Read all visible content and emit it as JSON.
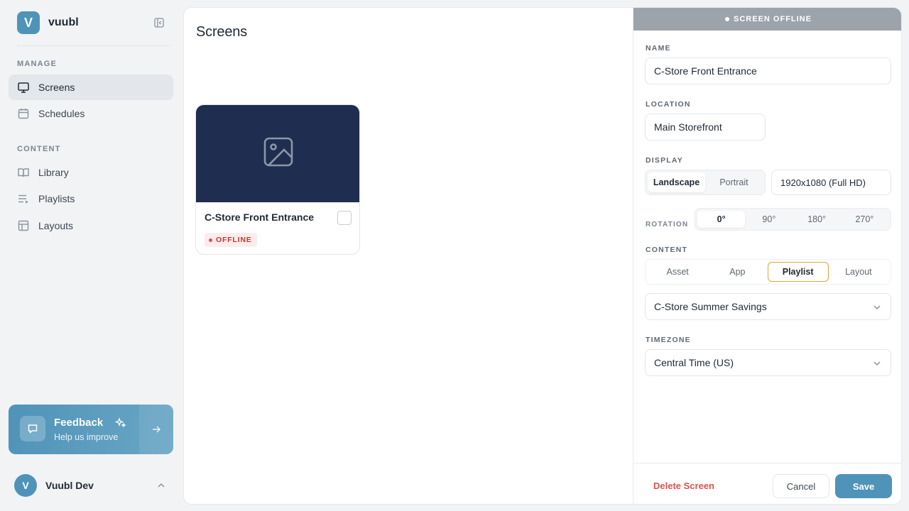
{
  "brand": {
    "logo_letter": "V",
    "name": "vuubl"
  },
  "sidebar": {
    "sections": [
      {
        "label": "MANAGE"
      },
      {
        "label": "CONTENT"
      }
    ],
    "items": [
      {
        "label": "Screens",
        "icon": "monitor-icon",
        "active": true
      },
      {
        "label": "Schedules",
        "icon": "calendar-icon"
      },
      {
        "label": "Library",
        "icon": "book-icon"
      },
      {
        "label": "Playlists",
        "icon": "playlist-icon"
      },
      {
        "label": "Layouts",
        "icon": "layout-icon"
      }
    ],
    "feedback": {
      "title": "Feedback",
      "subtitle": "Help us improve"
    },
    "user": {
      "initial": "V",
      "name": "Vuubl Dev"
    }
  },
  "main": {
    "title": "Screens",
    "cards": [
      {
        "name": "C-Store Front Entrance",
        "status": "OFFLINE"
      }
    ]
  },
  "drawer": {
    "banner": "SCREEN OFFLINE",
    "name_label": "NAME",
    "name_value": "C-Store Front Entrance",
    "location_label": "LOCATION",
    "location_value": "Main Storefront",
    "display_label": "DISPLAY",
    "orientation_options": [
      "Landscape",
      "Portrait"
    ],
    "orientation_selected": "Landscape",
    "resolution": "1920x1080 (Full HD)",
    "rotation_label": "ROTATION",
    "rotation_options": [
      "0°",
      "90°",
      "180°",
      "270°"
    ],
    "rotation_selected": "0°",
    "content_label": "CONTENT",
    "content_options": [
      "Asset",
      "App",
      "Playlist",
      "Layout"
    ],
    "content_selected": "Playlist",
    "playlist_value": "C-Store Summer Savings",
    "timezone_label": "TIMEZONE",
    "timezone_value": "Central Time (US)",
    "delete_label": "Delete Screen",
    "cancel_label": "Cancel",
    "save_label": "Save"
  },
  "colors": {
    "accent": "#4f93b8",
    "offline_badge": "#c0392b",
    "selected_outline": "#e0a43b",
    "thumb_bg": "#1f2d50"
  }
}
